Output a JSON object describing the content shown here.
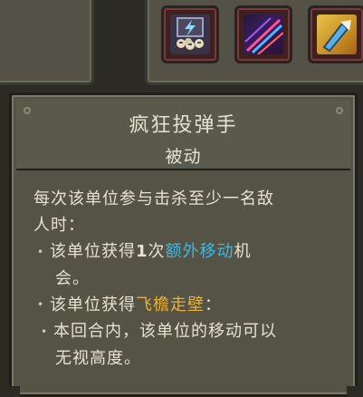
{
  "abilities": [
    {
      "name": "lightning-skulls-ability-icon"
    },
    {
      "name": "neon-streaks-ability-icon"
    },
    {
      "name": "golden-arrow-ability-icon"
    }
  ],
  "tooltip": {
    "title": "疯狂投弹手",
    "subtitle": "被动",
    "intro_line1": "每次该单位参与击杀至少一名敌",
    "intro_line2": "人时：",
    "bullet1_pre": "该单位获得",
    "bullet1_num": "1",
    "bullet1_mid": "次",
    "bullet1_highlight": "额外移动",
    "bullet1_post": "机",
    "bullet1_cont": "会。",
    "bullet2_pre": "该单位获得",
    "bullet2_highlight": "飞檐走壁",
    "bullet2_post": "：",
    "sub_bullet_line1": "本回合内，该单位的移动可以",
    "sub_bullet_line2": "无视高度。"
  },
  "colors": {
    "highlight_blue": "#3fb7e3",
    "highlight_yellow": "#e8b23a",
    "text": "#e6e2d2"
  }
}
